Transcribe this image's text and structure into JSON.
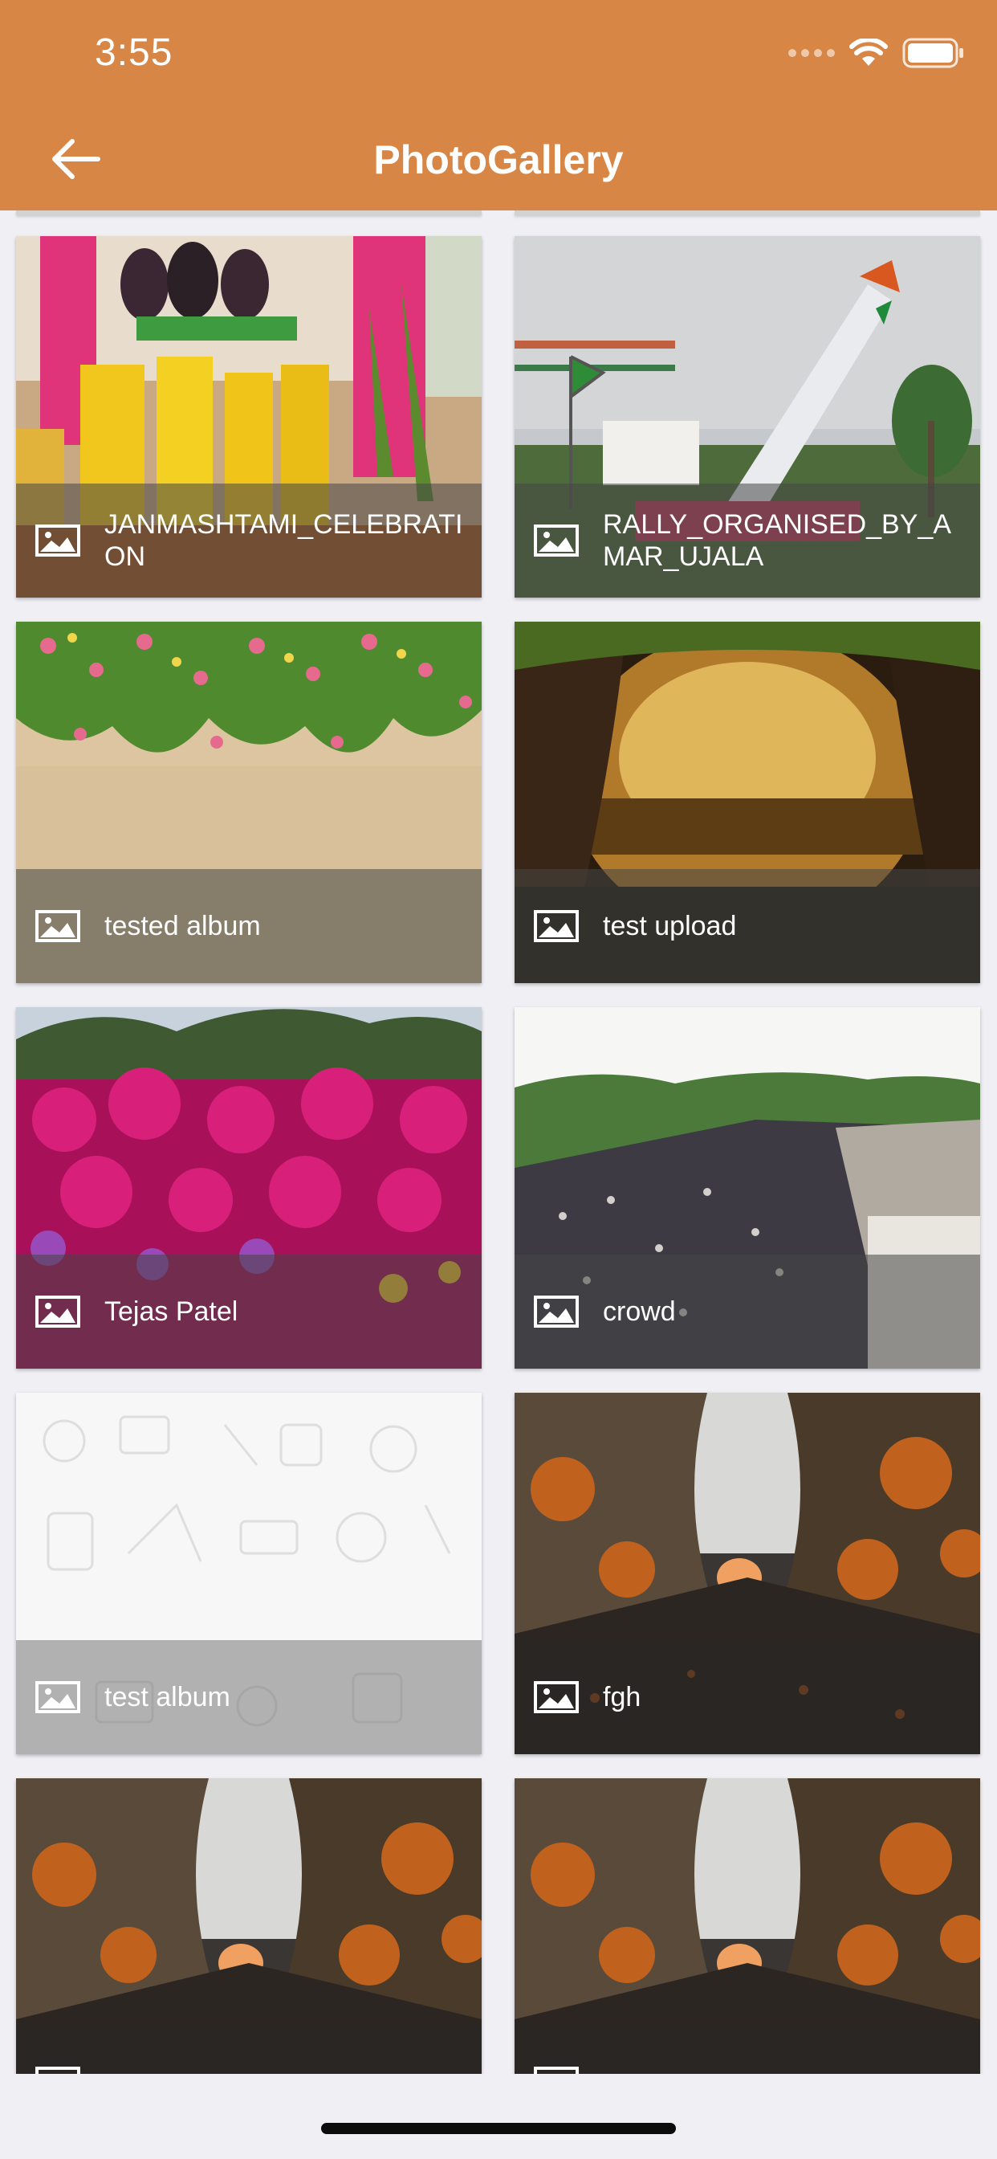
{
  "status_bar": {
    "time": "3:55"
  },
  "header": {
    "title": "PhotoGallery"
  },
  "albums": [
    {
      "name": "JANMASHTAMI_CELEBRATION"
    },
    {
      "name": "RALLY_ORGANISED_BY_AMAR_UJALA"
    },
    {
      "name": "tested album"
    },
    {
      "name": "test upload"
    },
    {
      "name": "Tejas Patel"
    },
    {
      "name": "crowd"
    },
    {
      "name": "test album"
    },
    {
      "name": "fgh"
    },
    {
      "name": ""
    },
    {
      "name": ""
    }
  ],
  "colors": {
    "header": "#d78646",
    "background": "#efeff4"
  }
}
